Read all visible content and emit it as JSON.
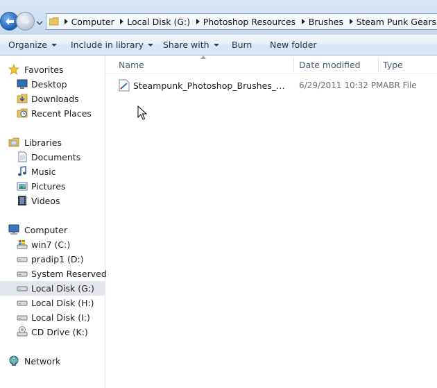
{
  "breadcrumb": [
    "Computer",
    "Local Disk (G:)",
    "Photoshop Resources",
    "Brushes",
    "Steam Punk Gears"
  ],
  "toolbar": {
    "organize": "Organize",
    "include_in_library": "Include in library",
    "share_with": "Share with",
    "burn": "Burn",
    "new_folder": "New folder"
  },
  "nav": {
    "favorites": {
      "label": "Favorites",
      "icon": "star-icon",
      "items": [
        {
          "label": "Desktop",
          "icon": "desktop-icon"
        },
        {
          "label": "Downloads",
          "icon": "downloads-icon"
        },
        {
          "label": "Recent Places",
          "icon": "recent-places-icon"
        }
      ]
    },
    "libraries": {
      "label": "Libraries",
      "icon": "libraries-icon",
      "items": [
        {
          "label": "Documents",
          "icon": "documents-icon"
        },
        {
          "label": "Music",
          "icon": "music-icon"
        },
        {
          "label": "Pictures",
          "icon": "pictures-icon"
        },
        {
          "label": "Videos",
          "icon": "videos-icon"
        }
      ]
    },
    "computer": {
      "label": "Computer",
      "icon": "computer-icon",
      "items": [
        {
          "label": "win7 (C:)",
          "icon": "windows-drive-icon"
        },
        {
          "label": "pradip1 (D:)",
          "icon": "drive-icon"
        },
        {
          "label": "System Reserved (F:)",
          "icon": "drive-icon"
        },
        {
          "label": "Local Disk (G:)",
          "icon": "drive-icon",
          "selected": true
        },
        {
          "label": "Local Disk (H:)",
          "icon": "drive-icon"
        },
        {
          "label": "Local Disk (I:)",
          "icon": "drive-icon"
        },
        {
          "label": "CD Drive (K:)",
          "icon": "cd-drive-icon"
        }
      ]
    },
    "network": {
      "label": "Network",
      "icon": "network-icon"
    }
  },
  "columns": {
    "name": "Name",
    "date_modified": "Date modified",
    "type": "Type"
  },
  "files": [
    {
      "name": "Steampunk_Photoshop_Brushes_by_hanaluku.abr",
      "date_modified": "6/29/2011 10:32 PM",
      "type": "ABR File",
      "icon": "brush-file-icon"
    }
  ],
  "colors": {
    "selection": "#e3e7ed",
    "header_text": "#4c607a",
    "toolbar_text": "#1a3350"
  }
}
